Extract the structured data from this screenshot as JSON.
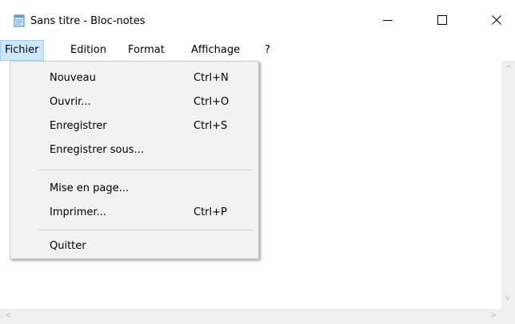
{
  "window": {
    "title": "Sans titre - Bloc-notes",
    "controls": {
      "minimize": "—",
      "maximize": "☐",
      "close": "✕"
    },
    "app_icon": "notepad-icon"
  },
  "menubar": {
    "items": [
      "Fichier",
      "Edition",
      "Format",
      "Affichage",
      "?"
    ],
    "active": "Fichier"
  },
  "file_menu": {
    "items": [
      {
        "label": "Nouveau",
        "shortcut": "Ctrl+N"
      },
      {
        "label": "Ouvrir...",
        "shortcut": "Ctrl+O"
      },
      {
        "label": "Enregistrer",
        "shortcut": "Ctrl+S"
      },
      {
        "label": "Enregistrer sous...",
        "shortcut": ""
      },
      {
        "label": "Mise en page...",
        "shortcut": ""
      },
      {
        "label": "Imprimer...",
        "shortcut": "Ctrl+P"
      },
      {
        "label": "Quitter",
        "shortcut": ""
      }
    ]
  },
  "editor": {
    "content": ""
  },
  "scrollbars": {
    "up": "^",
    "down": "v",
    "left": "<",
    "right": ">"
  },
  "colors": {
    "menu_highlight": "#cce8ff",
    "menu_background": "#f2f2f2",
    "scrollbar": "#f0f0f0"
  }
}
